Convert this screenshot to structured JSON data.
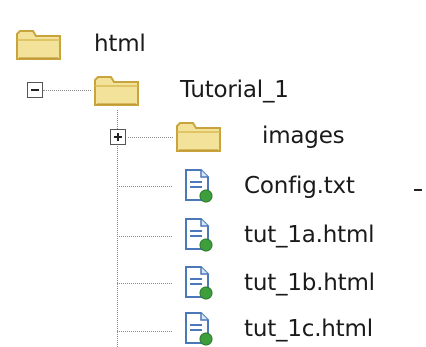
{
  "tree": {
    "root": {
      "label": "html",
      "icon": "folder-icon"
    },
    "tutorial": {
      "label": "Tutorial_1",
      "icon": "folder-icon",
      "expander": "minus"
    },
    "children": [
      {
        "label": "images",
        "icon": "folder-icon",
        "expander": "plus"
      },
      {
        "label": "Config.txt",
        "icon": "file-icon"
      },
      {
        "label": "tut_1a.html",
        "icon": "file-icon"
      },
      {
        "label": "tut_1b.html",
        "icon": "file-icon"
      },
      {
        "label": "tut_1c.html",
        "icon": "file-icon"
      }
    ]
  },
  "colors": {
    "folder_fill": "#f3e29a",
    "folder_edge": "#c9a43c",
    "file_green": "#3f9e3c",
    "file_blue": "#4a78b8"
  }
}
